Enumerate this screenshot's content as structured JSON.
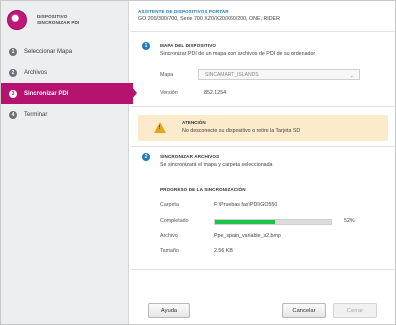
{
  "brand": {
    "line1": "DISPOSITIVO",
    "line2": "SINCRONIZAR PDI"
  },
  "nav": {
    "items": [
      {
        "num": "1",
        "label": "Seleccionar Mapa",
        "active": false
      },
      {
        "num": "2",
        "label": "Archivos",
        "active": false
      },
      {
        "num": "3",
        "label": "Sincronizar PDI",
        "active": true
      },
      {
        "num": "4",
        "label": "Terminar",
        "active": false
      }
    ]
  },
  "header": {
    "title": "ASISTENTE DE DISPOSITIVOS PORTAR",
    "subtitle": "GO 200/300/700, Serie 700 XZ0/X20/X60/200, ONE, RIDER"
  },
  "map_section": {
    "icon": "1",
    "title": "MAPA DEL DISPOSITIVO",
    "description": "Sincronizar PDI de un mapa con archivos de PDI de su ordenador",
    "map_label": "Mapa",
    "map_value": "SINCAMART_ISLANDS",
    "version_label": "Versión",
    "version_value": "852.1254"
  },
  "warning": {
    "icon": "warning-icon",
    "title": "ATENCIÓN",
    "text": "No desconecte su dispositivo o retire la Tarjeta SD"
  },
  "sync_section": {
    "icon": "2",
    "title": "SINCRONIZAR ARCHIVOS",
    "description": "Se sincronizará el mapa y carpeta seleccionada",
    "progress_title": "PROGRESO DE LA SINCRONIZACIÓN",
    "folder_label": "Carpeta",
    "folder_value": "F:\\Pruebas fax\\PDI\\GO550",
    "completed_label": "Completado",
    "completed_value": "52%",
    "progress_fraction": 0.52,
    "file_label": "Archivo",
    "file_value": "Ppe_spain_variable_s2.bmp",
    "size_label": "Tamaño",
    "size_value": "2.56 KB"
  },
  "footer": {
    "help_label": "Ayuda",
    "cancel_label": "Cancelar",
    "close_label": "Cerrar"
  },
  "colors": {
    "accent": "#b6126f",
    "header_blue": "#1e7bbf",
    "progress_green": "#1dc24a",
    "warning_bg": "#fcebcb"
  }
}
